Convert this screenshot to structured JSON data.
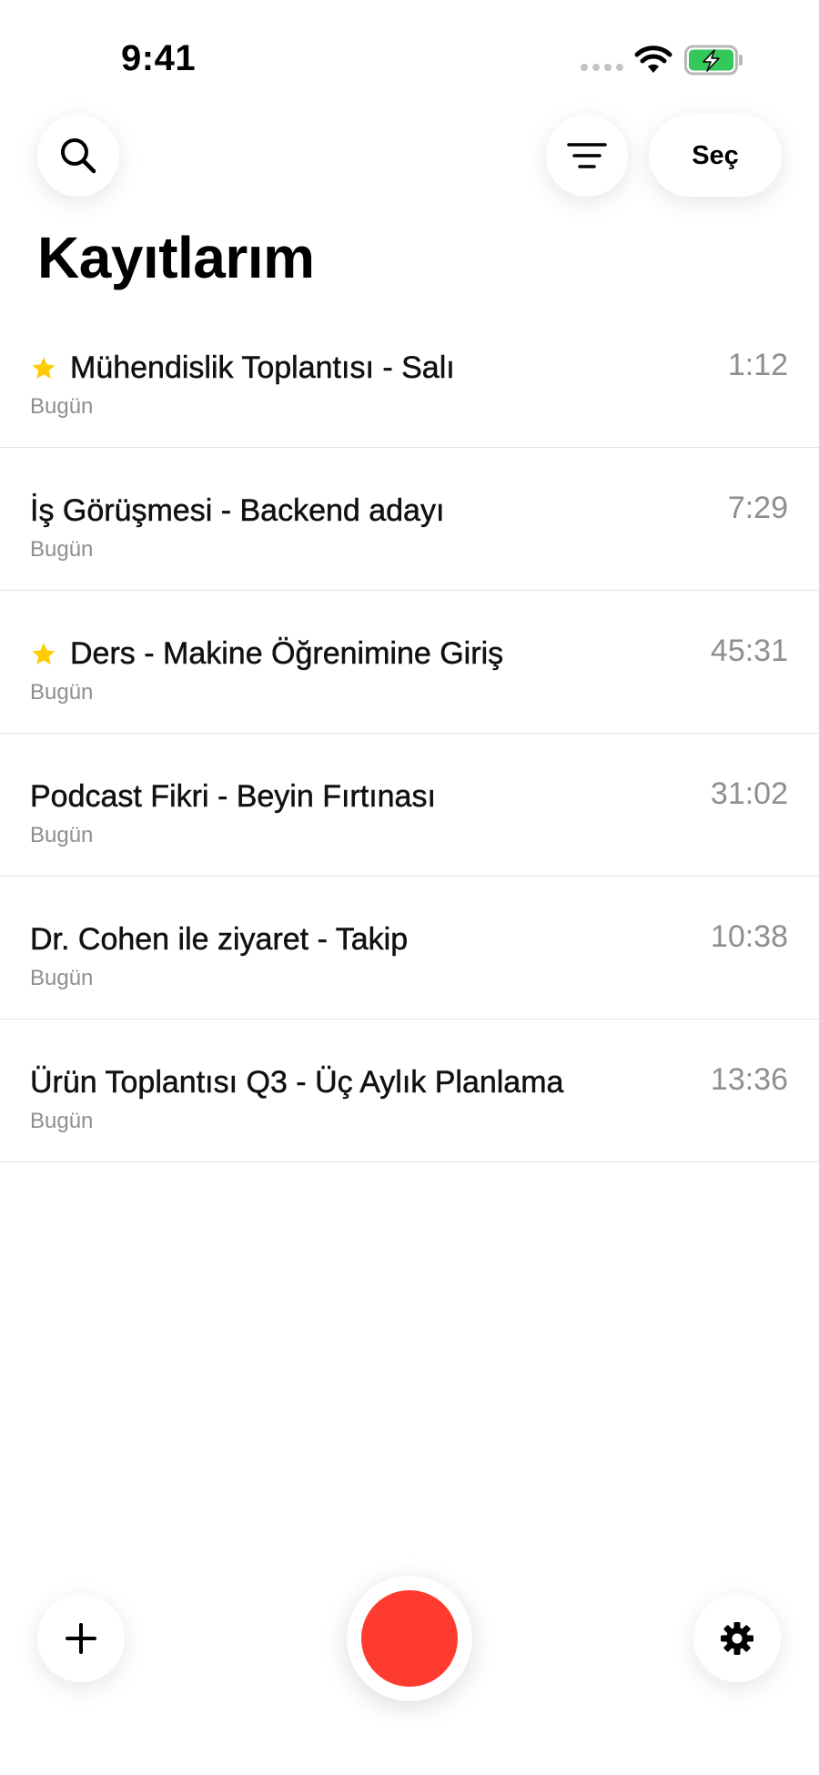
{
  "status_bar": {
    "time": "9:41"
  },
  "header": {
    "search_icon": "search-icon",
    "filter_icon": "filter-lines-icon",
    "select_label": "Seç",
    "title": "Kayıtlarım"
  },
  "recordings": [
    {
      "title": "Mühendislik Toplantısı - Salı",
      "date": "Bugün",
      "duration": "1:12",
      "starred": true
    },
    {
      "title": "İş Görüşmesi - Backend adayı",
      "date": "Bugün",
      "duration": "7:29",
      "starred": false
    },
    {
      "title": "Ders - Makine Öğrenimine Giriş",
      "date": "Bugün",
      "duration": "45:31",
      "starred": true
    },
    {
      "title": "Podcast Fikri - Beyin Fırtınası",
      "date": "Bugün",
      "duration": "31:02",
      "starred": false
    },
    {
      "title": "Dr. Cohen ile ziyaret - Takip",
      "date": "Bugün",
      "duration": "10:38",
      "starred": false
    },
    {
      "title": "Ürün Toplantısı Q3 - Üç Aylık Planlama",
      "date": "Bugün",
      "duration": "13:36",
      "starred": false
    }
  ],
  "bottom_bar": {
    "add_icon": "plus-icon",
    "record_icon": "record-icon",
    "settings_icon": "gear-icon"
  },
  "colors": {
    "accent_record": "#ff3b30",
    "star": "#ffcc00",
    "battery_fill": "#34c759",
    "secondary_text": "#8e8e93"
  }
}
